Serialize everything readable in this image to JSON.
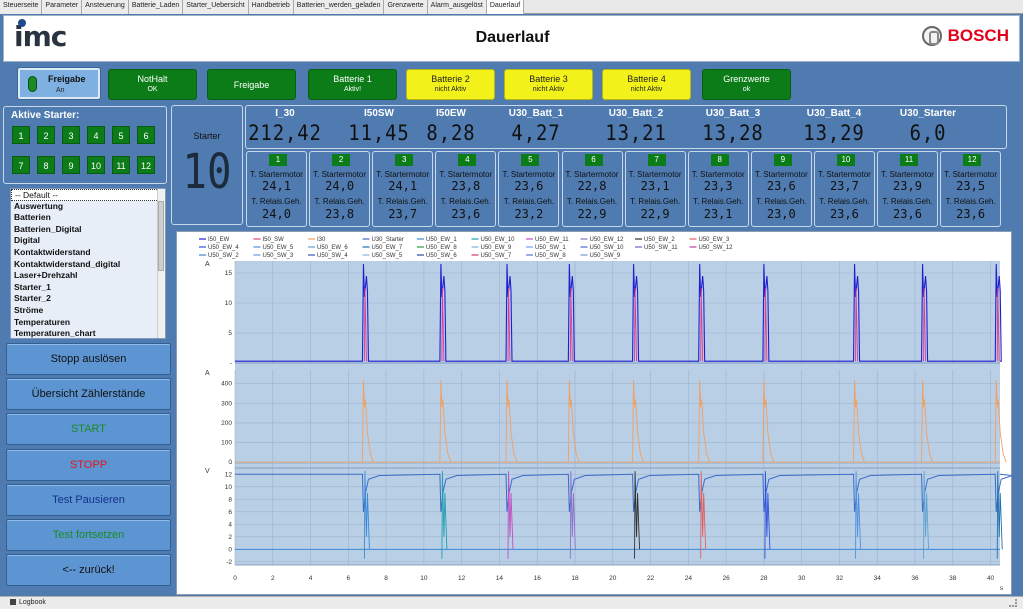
{
  "tabs": [
    "Steuerseite",
    "Parameter",
    "Ansteuerung",
    "Batterie_Laden",
    "Starter_Uebersicht",
    "Handbetrieb",
    "Batterien_werden_geladen",
    "Grenzwerte",
    "Alarm_ausgelöst",
    "Dauerlauf"
  ],
  "active_tab": "Dauerlauf",
  "header": {
    "logo": "imc",
    "title": "Dauerlauf",
    "brand": "BOSCH"
  },
  "toggle": {
    "label": "Freigabe",
    "state": "An"
  },
  "status_buttons": [
    {
      "label": "NotHalt",
      "sub": "OK",
      "color": "green"
    },
    {
      "label": "Freigabe",
      "sub": "",
      "color": "green"
    },
    {
      "label": "Batterie 1",
      "sub": "Aktiv!",
      "color": "green"
    },
    {
      "label": "Batterie 2",
      "sub": "nicht Aktiv",
      "color": "yellow"
    },
    {
      "label": "Batterie 3",
      "sub": "nicht Aktiv",
      "color": "yellow"
    },
    {
      "label": "Batterie 4",
      "sub": "nicht Aktiv",
      "color": "yellow"
    },
    {
      "label": "Grenzwerte",
      "sub": "ok",
      "color": "green"
    }
  ],
  "starters": {
    "title": "Aktive Starter:",
    "numbers": [
      "1",
      "2",
      "3",
      "4",
      "5",
      "6",
      "7",
      "8",
      "9",
      "10",
      "11",
      "12"
    ]
  },
  "list": {
    "items": [
      "-- Default --",
      "Auswertung",
      "Batterien",
      "Batterien_Digital",
      "Digital",
      "Kontaktwiderstand",
      "Kontaktwiderstand_digital",
      "Laser+Drehzahl",
      "Starter_1",
      "Starter_2",
      "Ströme",
      "Temperaturen",
      "Temperaturen_chart"
    ],
    "selected": 0
  },
  "buttons": [
    {
      "label": "Stopp auslösen",
      "color": "#111111"
    },
    {
      "label": "Übersicht Zählerstände",
      "color": "#111111"
    },
    {
      "label": "START",
      "color": "#1a8a26"
    },
    {
      "label": "STOPP",
      "color": "#e01818"
    },
    {
      "label": "Test Pausieren",
      "color": "#15308c"
    },
    {
      "label": "Test fortsetzen",
      "color": "#1a8a26"
    },
    {
      "label": "<-- zurück!",
      "color": "#111111"
    }
  ],
  "starter_display": {
    "label": "Starter",
    "value": "10"
  },
  "measurements": [
    {
      "label": "I_30",
      "value": "212,42"
    },
    {
      "label": "I50SW",
      "value": "11,45"
    },
    {
      "label": "I50EW",
      "value": "8,28"
    },
    {
      "label": "U30_Batt_1",
      "value": "4,27"
    },
    {
      "label": "U30_Batt_2",
      "value": "13,21"
    },
    {
      "label": "U30_Batt_3",
      "value": "13,28"
    },
    {
      "label": "U30_Batt_4",
      "value": "13,29"
    },
    {
      "label": "U30_Starter",
      "value": "6,0"
    }
  ],
  "cells": {
    "label_motor": "T. Startermotor",
    "label_relais": "T. Relais.Geh.",
    "items": [
      {
        "num": "1",
        "motor": "24,1",
        "relais": "24,0"
      },
      {
        "num": "2",
        "motor": "24,0",
        "relais": "23,8"
      },
      {
        "num": "3",
        "motor": "24,1",
        "relais": "23,7"
      },
      {
        "num": "4",
        "motor": "23,8",
        "relais": "23,6"
      },
      {
        "num": "5",
        "motor": "23,6",
        "relais": "23,2"
      },
      {
        "num": "6",
        "motor": "22,8",
        "relais": "22,9"
      },
      {
        "num": "7",
        "motor": "23,1",
        "relais": "22,9"
      },
      {
        "num": "8",
        "motor": "23,3",
        "relais": "23,1"
      },
      {
        "num": "9",
        "motor": "23,6",
        "relais": "23,0"
      },
      {
        "num": "10",
        "motor": "23,7",
        "relais": "23,6"
      },
      {
        "num": "11",
        "motor": "23,9",
        "relais": "23,6"
      },
      {
        "num": "12",
        "motor": "23,5",
        "relais": "23,6"
      }
    ]
  },
  "chart_data": {
    "type": "line",
    "legend_placement": "top",
    "legend": [
      {
        "name": "I50_EW",
        "color": "#1f1fd0"
      },
      {
        "name": "I50_SW",
        "color": "#e03c8c"
      },
      {
        "name": "I30",
        "color": "#f0a060"
      },
      {
        "name": "U30_Starter",
        "color": "#3c6cc8"
      },
      {
        "name": "U50_EW_1",
        "color": "#3a8ad8"
      },
      {
        "name": "U50_EW_10",
        "color": "#20a0b0"
      },
      {
        "name": "U50_EW_11",
        "color": "#c050c0"
      },
      {
        "name": "U50_EW_12",
        "color": "#8a70c8"
      },
      {
        "name": "U50_EW_2",
        "color": "#303030"
      },
      {
        "name": "U50_EW_3",
        "color": "#e06060"
      },
      {
        "name": "U50_EW_4",
        "color": "#3050e0"
      },
      {
        "name": "U50_EW_5",
        "color": "#5090e0"
      },
      {
        "name": "U50_EW_6",
        "color": "#60a0d0"
      },
      {
        "name": "U50_EW_7",
        "color": "#2070b0"
      },
      {
        "name": "U50_EW_8",
        "color": "#20a040"
      },
      {
        "name": "U50_EW_9",
        "color": "#80b0e0"
      },
      {
        "name": "U50_SW_1",
        "color": "#70a0f0"
      },
      {
        "name": "U50_SW_10",
        "color": "#5068c8"
      },
      {
        "name": "U50_SW_11",
        "color": "#7060c0"
      },
      {
        "name": "U50_SW_12",
        "color": "#c040a0"
      },
      {
        "name": "U50_SW_2",
        "color": "#4080d0"
      },
      {
        "name": "U50_SW_3",
        "color": "#6898d8"
      },
      {
        "name": "U50_SW_4",
        "color": "#3858b8"
      },
      {
        "name": "U50_SW_5",
        "color": "#8ab8e8"
      },
      {
        "name": "U50_SW_6",
        "color": "#2848a8"
      },
      {
        "name": "U50_SW_7",
        "color": "#d04060"
      },
      {
        "name": "U50_SW_8",
        "color": "#5878d0"
      },
      {
        "name": "U50_SW_9",
        "color": "#7898d8"
      }
    ],
    "panels": [
      {
        "ylabel": "A",
        "yticks": [
          "15",
          "10",
          "5",
          "-"
        ],
        "ylim": [
          0,
          17
        ]
      },
      {
        "ylabel": "A",
        "yticks": [
          "400",
          "300",
          "200",
          "100",
          "0",
          "-"
        ],
        "ylim": [
          -30,
          470
        ]
      },
      {
        "ylabel": "V",
        "yticks": [
          "12",
          "10",
          "8",
          "6",
          "4",
          "2",
          "0",
          "-2"
        ],
        "ylim": [
          -2.5,
          13
        ]
      }
    ],
    "xticks": [
      0,
      2,
      4,
      6,
      8,
      10,
      12,
      14,
      16,
      18,
      20,
      22,
      24,
      26,
      28,
      30,
      32,
      34,
      36,
      38,
      40
    ],
    "xunit": "s",
    "xlim": [
      0,
      40.5
    ],
    "pulse_times": [
      6.8,
      10.9,
      14.4,
      17.7,
      21.1,
      24.6,
      28.0,
      32.8,
      36.4,
      40.3
    ]
  },
  "bottom": {
    "label": "Logbook"
  }
}
